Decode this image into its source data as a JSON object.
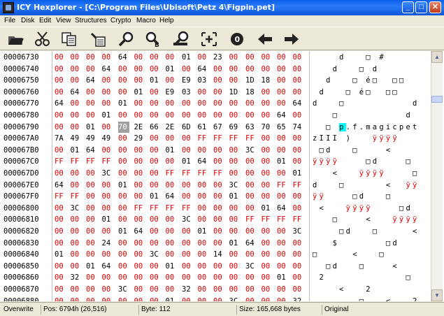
{
  "window": {
    "title": "ICY Hexplorer - [C:\\Program Files\\Ubisoft\\Petz 4\\Figpin.pet]"
  },
  "menu": [
    "File",
    "Disk",
    "Edit",
    "View",
    "Structures",
    "Crypto",
    "Macro",
    "Help"
  ],
  "toolbar_icons": [
    "open-folder-icon",
    "cut-icon",
    "copy-icon",
    "paste-icon",
    "find-icon",
    "find-replace-icon",
    "find-next-icon",
    "goto-icon",
    "info-icon",
    "back-arrow-icon",
    "forward-arrow-icon"
  ],
  "rows": [
    {
      "addr": "00006730",
      "bytes": [
        "00",
        "00",
        "00",
        "00",
        "64",
        "00",
        "00",
        "00",
        "01",
        "00",
        "23",
        "00",
        "00",
        "00",
        "00",
        "00"
      ],
      "ascii": "    d   □ #     "
    },
    {
      "addr": "00006740",
      "bytes": [
        "00",
        "00",
        "00",
        "64",
        "00",
        "00",
        "00",
        "01",
        "00",
        "64",
        "00",
        "00",
        "00",
        "00",
        "00",
        "00"
      ],
      "ascii": "   d   □ d      "
    },
    {
      "addr": "00006750",
      "bytes": [
        "00",
        "00",
        "64",
        "00",
        "00",
        "00",
        "01",
        "00",
        "E9",
        "03",
        "00",
        "00",
        "1D",
        "18",
        "00",
        "00"
      ],
      "ascii": "  d   □ é□  □□  "
    },
    {
      "addr": "00006760",
      "bytes": [
        "00",
        "64",
        "00",
        "00",
        "00",
        "01",
        "00",
        "E9",
        "03",
        "00",
        "00",
        "1D",
        "18",
        "00",
        "00",
        "00"
      ],
      "ascii": " d   □ é□  □□   "
    },
    {
      "addr": "00006770",
      "bytes": [
        "64",
        "00",
        "00",
        "00",
        "01",
        "00",
        "00",
        "00",
        "00",
        "00",
        "00",
        "00",
        "00",
        "00",
        "00",
        "64"
      ],
      "ascii": "d   □          d"
    },
    {
      "addr": "00006780",
      "bytes": [
        "00",
        "00",
        "00",
        "01",
        "00",
        "00",
        "00",
        "00",
        "00",
        "00",
        "00",
        "00",
        "00",
        "00",
        "64",
        "00"
      ],
      "ascii": "   □          d "
    },
    {
      "addr": "00006790",
      "bytes": [
        "00",
        "00",
        "01",
        "00",
        "70",
        "2E",
        "66",
        "2E",
        "6D",
        "61",
        "67",
        "69",
        "63",
        "70",
        "65",
        "74"
      ],
      "ascii": "  □ p.f.magicpet"
    },
    {
      "addr": "000067A0",
      "bytes": [
        "7A",
        "49",
        "49",
        "49",
        "00",
        "29",
        "00",
        "00",
        "00",
        "FF",
        "FF",
        "FF",
        "FF",
        "00",
        "00",
        "00"
      ],
      "ascii": "zIII )   ÿÿÿÿ   "
    },
    {
      "addr": "000067B0",
      "bytes": [
        "00",
        "01",
        "64",
        "00",
        "00",
        "00",
        "00",
        "01",
        "00",
        "00",
        "00",
        "00",
        "3C",
        "00",
        "00",
        "00"
      ],
      "ascii": " □d   □    <    "
    },
    {
      "addr": "000067C0",
      "bytes": [
        "FF",
        "FF",
        "FF",
        "FF",
        "00",
        "00",
        "00",
        "00",
        "01",
        "64",
        "00",
        "00",
        "00",
        "00",
        "01",
        "00"
      ],
      "ascii": "ÿÿÿÿ    □d    □ "
    },
    {
      "addr": "000067D0",
      "bytes": [
        "00",
        "00",
        "00",
        "3C",
        "00",
        "00",
        "00",
        "FF",
        "FF",
        "FF",
        "FF",
        "00",
        "00",
        "00",
        "00",
        "01"
      ],
      "ascii": "   <   ÿÿÿÿ    □"
    },
    {
      "addr": "000067E0",
      "bytes": [
        "64",
        "00",
        "00",
        "00",
        "01",
        "00",
        "00",
        "00",
        "00",
        "00",
        "00",
        "3C",
        "00",
        "00",
        "FF",
        "FF"
      ],
      "ascii": "d   □      <  ÿÿ"
    },
    {
      "addr": "000067F0",
      "bytes": [
        "FF",
        "FF",
        "00",
        "00",
        "00",
        "00",
        "01",
        "64",
        "00",
        "00",
        "00",
        "01",
        "00",
        "00",
        "00",
        "00"
      ],
      "ascii": "ÿÿ    □d   □    "
    },
    {
      "addr": "00006800",
      "bytes": [
        "00",
        "3C",
        "00",
        "00",
        "00",
        "FF",
        "FF",
        "FF",
        "FF",
        "00",
        "00",
        "00",
        "00",
        "01",
        "64",
        "00"
      ],
      "ascii": " <   ÿÿÿÿ    □d "
    },
    {
      "addr": "00006810",
      "bytes": [
        "00",
        "00",
        "00",
        "01",
        "00",
        "00",
        "00",
        "00",
        "3C",
        "00",
        "00",
        "00",
        "FF",
        "FF",
        "FF",
        "FF"
      ],
      "ascii": "   □    <   ÿÿÿÿ"
    },
    {
      "addr": "00006820",
      "bytes": [
        "00",
        "00",
        "00",
        "00",
        "01",
        "64",
        "00",
        "00",
        "00",
        "01",
        "00",
        "00",
        "00",
        "00",
        "00",
        "3C"
      ],
      "ascii": "    □d   □     <"
    },
    {
      "addr": "00006830",
      "bytes": [
        "00",
        "00",
        "00",
        "24",
        "00",
        "00",
        "00",
        "00",
        "00",
        "00",
        "00",
        "01",
        "64",
        "00",
        "00",
        "00"
      ],
      "ascii": "   $       □d   "
    },
    {
      "addr": "00006840",
      "bytes": [
        "01",
        "00",
        "00",
        "00",
        "00",
        "00",
        "3C",
        "00",
        "00",
        "00",
        "14",
        "00",
        "00",
        "00",
        "00",
        "00"
      ],
      "ascii": "□     <   □     "
    },
    {
      "addr": "00006850",
      "bytes": [
        "00",
        "00",
        "01",
        "64",
        "00",
        "00",
        "00",
        "01",
        "00",
        "00",
        "00",
        "00",
        "3C",
        "00",
        "00",
        "00"
      ],
      "ascii": "  □d   □    <   "
    },
    {
      "addr": "00006860",
      "bytes": [
        "00",
        "32",
        "00",
        "00",
        "00",
        "00",
        "00",
        "00",
        "00",
        "00",
        "00",
        "00",
        "00",
        "00",
        "01",
        "00"
      ],
      "ascii": " 2            □ "
    },
    {
      "addr": "00006870",
      "bytes": [
        "00",
        "00",
        "00",
        "00",
        "3C",
        "00",
        "00",
        "00",
        "32",
        "00",
        "00",
        "00",
        "00",
        "00",
        "00",
        "00"
      ],
      "ascii": "    <   2       "
    },
    {
      "addr": "00006880",
      "bytes": [
        "00",
        "00",
        "00",
        "00",
        "00",
        "00",
        "00",
        "01",
        "00",
        "00",
        "00",
        "3C",
        "00",
        "00",
        "00",
        "32"
      ],
      "ascii": "       □   <   2"
    }
  ],
  "selected_byte": {
    "row": 6,
    "col": 4
  },
  "cursor_char": {
    "row": 6,
    "col": 4
  },
  "status": {
    "mode": "Overwrite",
    "position": "Pos: 6794h (26,516)",
    "byte": "Byte: 112",
    "size": "Size: 165,668 bytes",
    "state": "Original"
  },
  "colors": {
    "zero_byte": "#e00000",
    "nonzero_byte": "#000000",
    "cursor": "#00ffff",
    "title_bar": "#0a5ee8"
  }
}
